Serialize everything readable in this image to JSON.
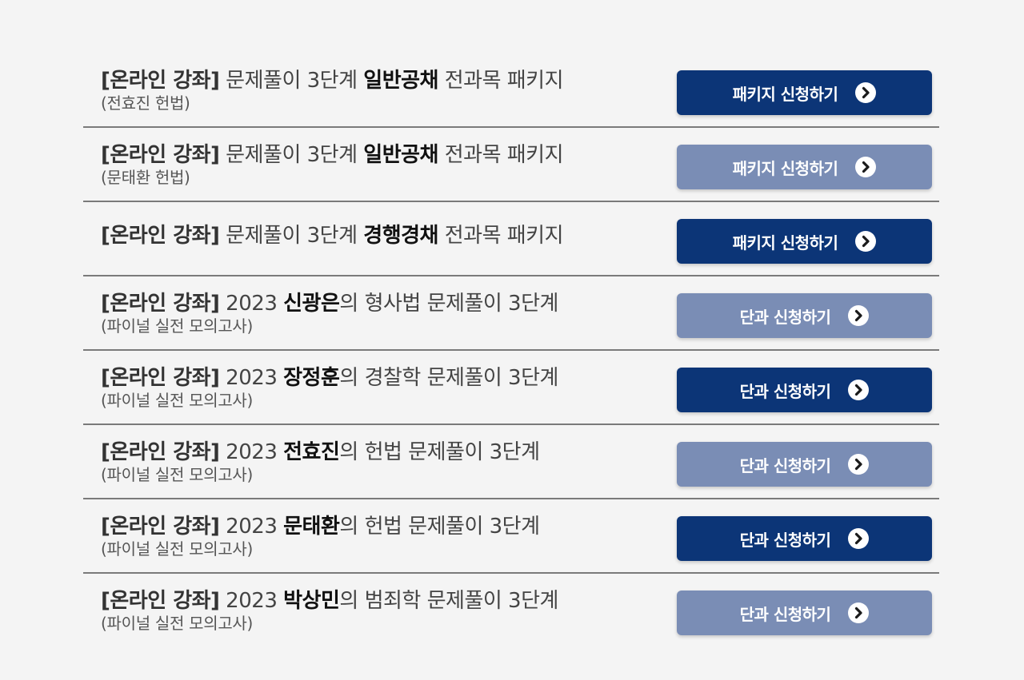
{
  "colors": {
    "button_dark": "#0c3577",
    "button_light": "#7a8db5",
    "divider": "#7a7a7a",
    "background": "#f4f4f4"
  },
  "rows": [
    {
      "prefix": "[온라인 강좌]",
      "pre": " 문제풀이 3단계 ",
      "highlight": "일반공채",
      "post": " 전과목 패키지",
      "subtitle": "(전효진 헌법)",
      "button_label": "패키지 신청하기",
      "button_style": "dark"
    },
    {
      "prefix": "[온라인 강좌]",
      "pre": " 문제풀이 3단계 ",
      "highlight": "일반공채",
      "post": " 전과목 패키지",
      "subtitle": "(문태환 헌법)",
      "button_label": "패키지 신청하기",
      "button_style": "light"
    },
    {
      "prefix": "[온라인 강좌]",
      "pre": " 문제풀이 3단계 ",
      "highlight": "경행경채",
      "post": " 전과목 패키지",
      "subtitle": "",
      "button_label": "패키지 신청하기",
      "button_style": "dark"
    },
    {
      "prefix": "[온라인 강좌]",
      "pre": " 2023 ",
      "highlight": "신광은",
      "post": "의 형사법 문제풀이 3단계",
      "subtitle": "(파이널 실전 모의고사)",
      "button_label": "단과 신청하기",
      "button_style": "light"
    },
    {
      "prefix": "[온라인 강좌]",
      "pre": " 2023 ",
      "highlight": "장정훈",
      "post": "의 경찰학 문제풀이 3단계",
      "subtitle": "(파이널 실전 모의고사)",
      "button_label": "단과 신청하기",
      "button_style": "dark"
    },
    {
      "prefix": "[온라인 강좌]",
      "pre": " 2023 ",
      "highlight": "전효진",
      "post": "의 헌법 문제풀이 3단계",
      "subtitle": "(파이널 실전 모의고사)",
      "button_label": "단과 신청하기",
      "button_style": "light"
    },
    {
      "prefix": "[온라인 강좌]",
      "pre": " 2023 ",
      "highlight": "문태환",
      "post": "의 헌법 문제풀이 3단계",
      "subtitle": "(파이널 실전 모의고사)",
      "button_label": "단과 신청하기",
      "button_style": "dark"
    },
    {
      "prefix": "[온라인 강좌]",
      "pre": " 2023 ",
      "highlight": "박상민",
      "post": "의 범죄학 문제풀이 3단계",
      "subtitle": "(파이널 실전 모의고사)",
      "button_label": "단과 신청하기",
      "button_style": "light"
    }
  ]
}
